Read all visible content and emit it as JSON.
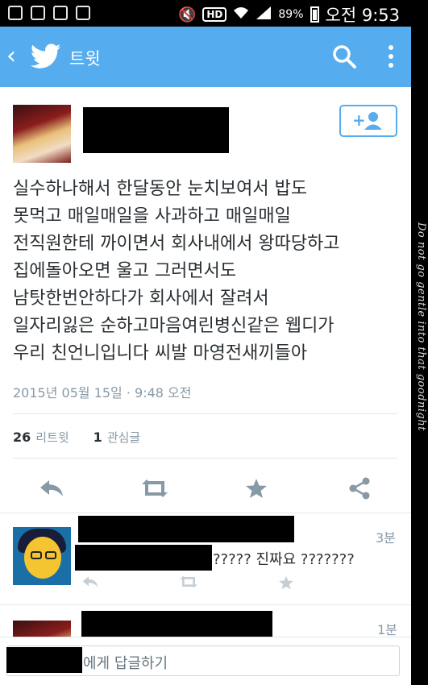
{
  "status_bar": {
    "battery_percent": "89%",
    "time": "오전 9:53",
    "hd_label": "HD",
    "left_icons": [
      "g-icon",
      "image-icon",
      "phone-update-icon",
      "recycle-icon"
    ],
    "right_icons": [
      "mute-icon",
      "hd-icon",
      "wifi-icon",
      "signal-icon",
      "battery-icon"
    ]
  },
  "app_bar": {
    "title": "트윗",
    "accent_color": "#55acee"
  },
  "tweet": {
    "follow_button_label": "+👤",
    "lines": [
      "실수하나해서 한달동안 눈치보여서 밥도",
      "못먹고 매일매일을 사과하고 매일매일",
      "전직원한테 까이면서 회사내에서 왕따당하고",
      "집에돌아오면 울고 그러면서도",
      "남탓한번안하다가 회사에서 잘려서",
      "일자리잃은 순하고마음여린병신같은 웹디가",
      "우리 친언니입니다 씨발 마영전새끼들아"
    ],
    "timestamp": "2015년 05월 15일 · 9:48 오전",
    "retweet_count": "26",
    "retweet_label": "리트윗",
    "like_count": "1",
    "like_label": "관심글"
  },
  "replies": [
    {
      "time": "3분",
      "text": "????? 진짜요 ???????"
    },
    {
      "time": "1분"
    }
  ],
  "reply_bar": {
    "placeholder_suffix": "에게 답글하기"
  },
  "side_caption": "Do not go gentle into that goodnight"
}
